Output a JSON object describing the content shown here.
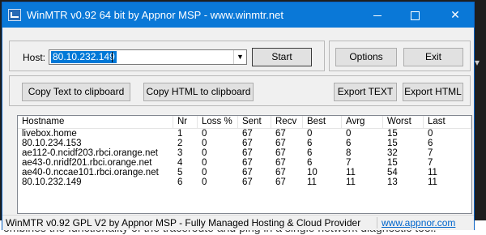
{
  "window": {
    "title": "WinMTR v0.92 64 bit by Appnor MSP - www.winmtr.net"
  },
  "controls": {
    "host_label": "Host:",
    "host_value": "80.10.232.149",
    "start_label": "Start",
    "options_label": "Options",
    "exit_label": "Exit",
    "copy_text_label": "Copy Text to clipboard",
    "copy_html_label": "Copy HTML to clipboard",
    "export_text_label": "Export TEXT",
    "export_html_label": "Export HTML"
  },
  "table": {
    "columns": [
      "Hostname",
      "Nr",
      "Loss %",
      "Sent",
      "Recv",
      "Best",
      "Avrg",
      "Worst",
      "Last"
    ],
    "rows": [
      [
        "livebox.home",
        "1",
        "0",
        "67",
        "67",
        "0",
        "0",
        "15",
        "0"
      ],
      [
        "80.10.234.153",
        "2",
        "0",
        "67",
        "67",
        "6",
        "6",
        "15",
        "6"
      ],
      [
        "ae112-0.ncidf203.rbci.orange.net",
        "3",
        "0",
        "67",
        "67",
        "6",
        "8",
        "32",
        "7"
      ],
      [
        "ae43-0.nridf201.rbci.orange.net",
        "4",
        "0",
        "67",
        "67",
        "6",
        "7",
        "15",
        "7"
      ],
      [
        "ae40-0.nccae101.rbci.orange.net",
        "5",
        "0",
        "67",
        "67",
        "10",
        "11",
        "54",
        "11"
      ],
      [
        "80.10.232.149",
        "6",
        "0",
        "67",
        "67",
        "11",
        "11",
        "13",
        "11"
      ]
    ]
  },
  "status": {
    "text": "WinMTR v0.92 GPL V2 by Appnor MSP - Fully Managed Hosting & Cloud Provider",
    "link": "www.appnor.com"
  },
  "background": {
    "text": "ombines the functionality of the traceroute and ping in a single network diagnostic tool."
  }
}
